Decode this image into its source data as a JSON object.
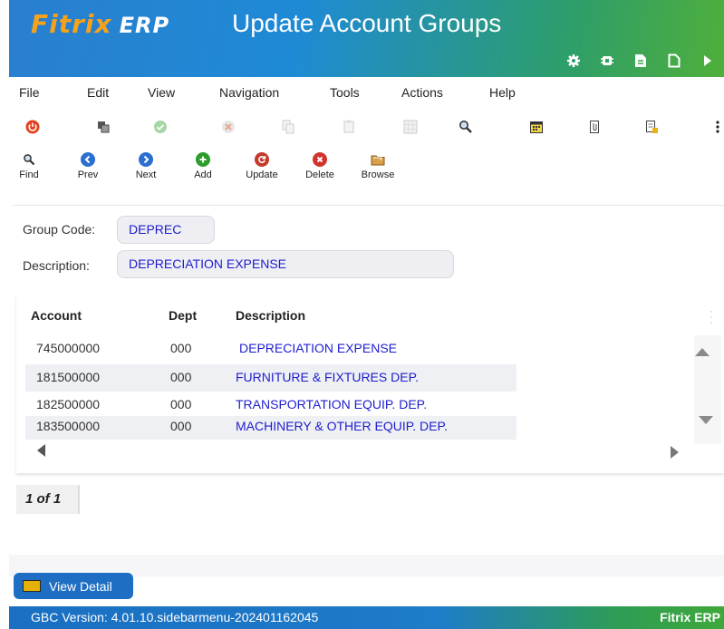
{
  "app": {
    "logo_main": "Fitrix",
    "logo_erp": "ERP",
    "title": "Update Account Groups"
  },
  "titlebar_icons": [
    "gear-icon",
    "chip-icon",
    "document-icon",
    "new-page-icon",
    "play-icon"
  ],
  "menu": [
    "File",
    "Edit",
    "View",
    "Navigation",
    "Tools",
    "Actions",
    "Help"
  ],
  "toolbar_row1_icons": [
    "power-icon",
    "copy-window-icon",
    "check-icon",
    "cancel-icon",
    "copy-icon",
    "paste-icon",
    "grid-icon",
    "zoom-icon",
    "calendar-icon",
    "attach-icon",
    "notes-icon",
    "more-icon"
  ],
  "toolbar_buttons": [
    {
      "label": "Find",
      "icon": "search-icon"
    },
    {
      "label": "Prev",
      "icon": "arrow-left-icon",
      "color": "#2b6fd1"
    },
    {
      "label": "Next",
      "icon": "arrow-right-icon",
      "color": "#2b6fd1"
    },
    {
      "label": "Add",
      "icon": "plus-icon",
      "color": "#2a9d2a"
    },
    {
      "label": "Update",
      "icon": "refresh-icon",
      "color": "#c43a2a"
    },
    {
      "label": "Delete",
      "icon": "x-icon",
      "color": "#d0342c"
    },
    {
      "label": "Browse",
      "icon": "folder-icon"
    }
  ],
  "form": {
    "group_code_label": "Group Code:",
    "group_code_value": "DEPREC",
    "description_label": "Description:",
    "description_value": "DEPRECIATION EXPENSE"
  },
  "table": {
    "columns": [
      "Account",
      "Dept",
      "Description"
    ],
    "rows": [
      {
        "account": "745000000",
        "dept": "000",
        "description": "DEPRECIATION EXPENSE"
      },
      {
        "account": "181500000",
        "dept": "000",
        "description": "FURNITURE & FIXTURES DEP."
      },
      {
        "account": "182500000",
        "dept": "000",
        "description": "TRANSPORTATION EQUIP. DEP."
      },
      {
        "account": "183500000",
        "dept": "000",
        "description": "MACHINERY & OTHER EQUIP. DEP."
      }
    ]
  },
  "pager": "1 of 1",
  "view_detail_label": "View Detail",
  "status": {
    "version": "GBC Version: 4.01.10.sidebarmenu-202401162045",
    "brand": "Fitrix ERP"
  },
  "colors": {
    "accent": "#1e6fc4",
    "link_text": "#1d1dcf",
    "logo_orange": "#f7a21b"
  }
}
